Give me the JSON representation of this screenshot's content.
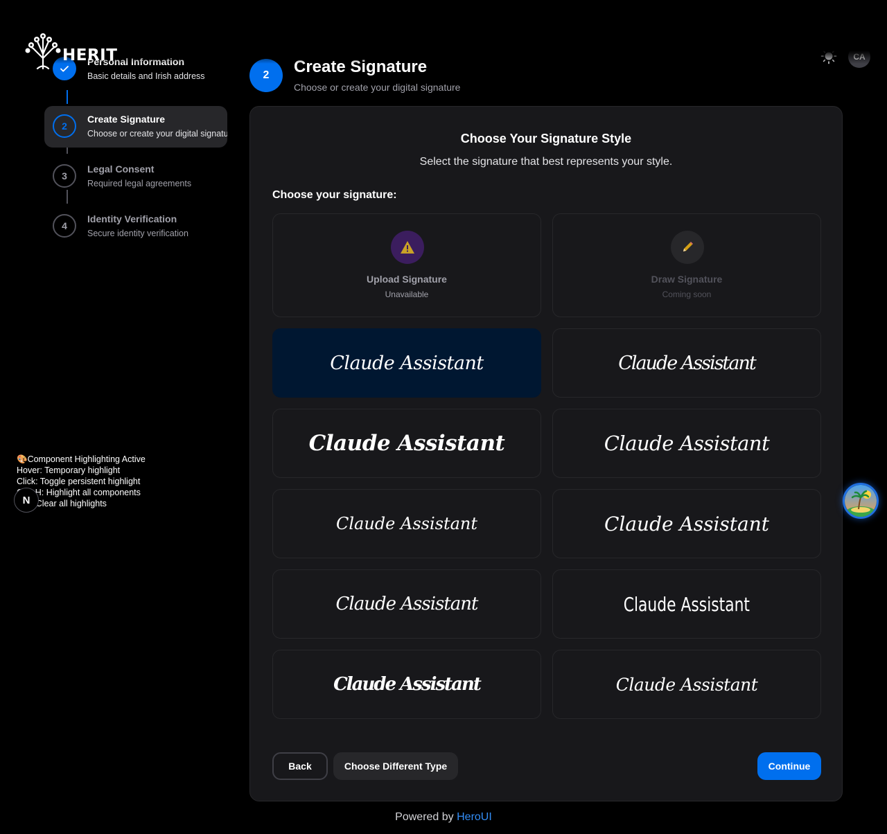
{
  "brand": {
    "name": "HERIT"
  },
  "header": {
    "theme_icon": "sun-icon",
    "avatar_initials": "CA"
  },
  "steps": [
    {
      "number": "1",
      "title": "Personal Information",
      "description": "Basic details and Irish address",
      "status": "completed"
    },
    {
      "number": "2",
      "title": "Create Signature",
      "description": "Choose or create your digital signature",
      "status": "current"
    },
    {
      "number": "3",
      "title": "Legal Consent",
      "description": "Required legal agreements",
      "status": "pending"
    },
    {
      "number": "4",
      "title": "Identity Verification",
      "description": "Secure identity verification",
      "status": "pending"
    }
  ],
  "main": {
    "step_number": "2",
    "title": "Create Signature",
    "subtitle": "Choose or create your digital signature"
  },
  "card": {
    "title": "Choose Your Signature Style",
    "subtitle": "Select the signature that best represents your style.",
    "choose_label": "Choose your signature:",
    "upload": {
      "title": "Upload Signature",
      "status": "Unavailable",
      "icon": "warning-icon"
    },
    "draw": {
      "title": "Draw Signature",
      "status": "Coming soon",
      "icon": "pencil-icon"
    },
    "signatures": [
      {
        "text": "Claude Assistant",
        "selected": true
      },
      {
        "text": "Claude Assistant",
        "selected": false
      },
      {
        "text": "Claude Assistant",
        "selected": false
      },
      {
        "text": "Claude Assistant",
        "selected": false
      },
      {
        "text": "Claude Assistant",
        "selected": false
      },
      {
        "text": "Claude Assistant",
        "selected": false
      },
      {
        "text": "Claude Assistant",
        "selected": false
      },
      {
        "text": "Claude Assistant",
        "selected": false
      },
      {
        "text": "Claude Assistant",
        "selected": false
      },
      {
        "text": "Claude Assistant",
        "selected": false
      }
    ],
    "buttons": {
      "back": "Back",
      "change_type": "Choose Different Type",
      "continue": "Continue"
    }
  },
  "footer": {
    "prefix": "Powered by",
    "link": "HeroUI"
  },
  "dev_overlay": {
    "lines": [
      "🎨Component Highlighting Active",
      "Hover: Temporary highlight",
      "Click: Toggle persistent highlight",
      "Ctrl+H: Highlight all components",
      "Esc: Clear all highlights"
    ],
    "next_badge": "N"
  },
  "colors": {
    "primary": "#006fee",
    "background": "#000000",
    "card": "#18181b",
    "selected": "#001731",
    "warning": "#c9a227"
  }
}
